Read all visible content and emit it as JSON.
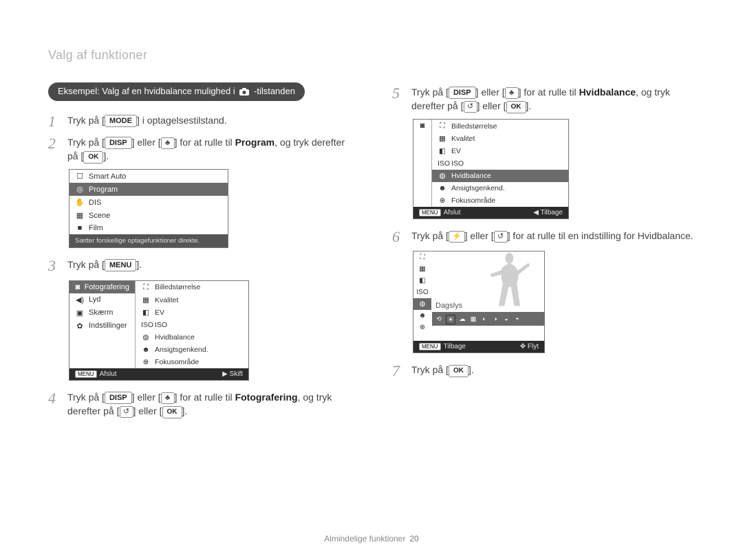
{
  "section_title": "Valg af funktioner",
  "example_label_a": "Eksempel: Valg af en hvidbalance mulighed i",
  "example_label_b": "-tilstanden",
  "buttons": {
    "mode": "MODE",
    "disp": "DISP",
    "menu": "MENU",
    "ok": "OK",
    "macro": "♣",
    "flash": "⚡",
    "timer": "↺"
  },
  "steps_left": {
    "s1_num": "1",
    "s1_a": "Tryk på [",
    "s1_c": "] i optagelsestilstand.",
    "s2_num": "2",
    "s2_a": "Tryk på [",
    "s2_b": "] eller [",
    "s2_c": "] for at rulle til ",
    "s2_bold": "Program",
    "s2_d": ", og tryk derefter på [",
    "s2_e": "].",
    "s3_num": "3",
    "s3_a": "Tryk på [",
    "s3_b": "].",
    "s4_num": "4",
    "s4_a": "Tryk på [",
    "s4_b": "] eller [",
    "s4_c": "] for at rulle til ",
    "s4_bold": "Fotografering",
    "s4_d": ", og tryk derefter på [",
    "s4_e": "] eller [",
    "s4_f": "]."
  },
  "steps_right": {
    "s5_num": "5",
    "s5_a": "Tryk på [",
    "s5_b": "] eller [",
    "s5_c": "] for at rulle til ",
    "s5_bold": "Hvidbalance",
    "s5_d": ", og tryk derefter på [",
    "s5_e": "] eller [",
    "s5_f": "].",
    "s6_num": "6",
    "s6_a": "Tryk på [",
    "s6_b": "] eller [",
    "s6_c": "] for at rulle til en indstilling for Hvidbalance.",
    "s7_num": "7",
    "s7_a": "Tryk på [",
    "s7_b": "]."
  },
  "panel_modes": {
    "items": [
      {
        "icon": "☐",
        "label": "Smart Auto"
      },
      {
        "icon": "◎",
        "label": "Program",
        "selected": true
      },
      {
        "icon": "✋",
        "label": "DIS"
      },
      {
        "icon": "▦",
        "label": "Scene"
      },
      {
        "icon": "■",
        "label": "Film"
      }
    ],
    "desc": "Sætter forskellige optagefunktioner direkte."
  },
  "panel_menu": {
    "left": [
      {
        "icon": "◙",
        "label": "Fotografering",
        "selected": true
      },
      {
        "icon": "◀)",
        "label": "Lyd"
      },
      {
        "icon": "▣",
        "label": "Skærm"
      },
      {
        "icon": "✿",
        "label": "Indstillinger"
      }
    ],
    "right": [
      {
        "icon": "⛶",
        "label": "Billedstørrelse"
      },
      {
        "icon": "▦",
        "label": "Kvalitet"
      },
      {
        "icon": "◧",
        "label": "EV"
      },
      {
        "icon": "ISO",
        "label": "ISO"
      },
      {
        "icon": "◍",
        "label": "Hvidbalance"
      },
      {
        "icon": "☻",
        "label": "Ansigtsgenkend."
      },
      {
        "icon": "⊕",
        "label": "Fokusområde"
      }
    ],
    "footer_left": "Afslut",
    "footer_right": "Skift",
    "footer_right_icon": "▶"
  },
  "panel_shoot": {
    "side_icon": "◙",
    "right": [
      {
        "icon": "⛶",
        "label": "Billedstørrelse"
      },
      {
        "icon": "▦",
        "label": "Kvalitet"
      },
      {
        "icon": "◧",
        "label": "EV"
      },
      {
        "icon": "ISO",
        "label": "ISO"
      },
      {
        "icon": "◍",
        "label": "Hvidbalance",
        "selected": true
      },
      {
        "icon": "☻",
        "label": "Ansigtsgenkend."
      },
      {
        "icon": "⊕",
        "label": "Fokusområde"
      }
    ],
    "footer_left": "Afslut",
    "footer_right": "Tilbage",
    "footer_right_icon": "◀"
  },
  "panel_wb": {
    "vicons": [
      "⛶",
      "▦",
      "◧",
      "ISO",
      "◍",
      "☻",
      "⊕"
    ],
    "sel_index": 4,
    "label": "Dagslys",
    "strip": [
      "⟲",
      "☀",
      "☁",
      "▦",
      "◐",
      "◑",
      "◒",
      "◓"
    ],
    "strip_sel": 1,
    "footer_left": "Tilbage",
    "footer_right": "Flyt",
    "footer_right_icon": "✥"
  },
  "footer": {
    "text": "Almindelige funktioner",
    "page": "20"
  }
}
